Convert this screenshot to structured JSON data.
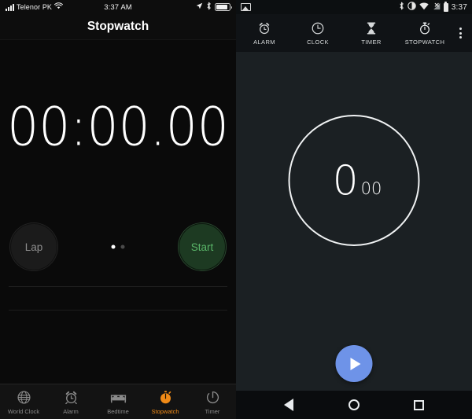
{
  "ios": {
    "status_bar": {
      "carrier": "Telenor PK",
      "time": "3:37 AM",
      "icons": [
        "signal-bars-icon",
        "wifi-icon",
        "location-arrow-icon",
        "bluetooth-icon",
        "battery-icon"
      ]
    },
    "title": "Stopwatch",
    "elapsed_time": "00:00.00",
    "lap_label": "Lap",
    "start_label": "Start",
    "page_dots": {
      "count": 2,
      "active_index": 0
    },
    "tabs": [
      {
        "label": "World Clock",
        "icon": "globe-icon",
        "active": false
      },
      {
        "label": "Alarm",
        "icon": "alarm-clock-icon",
        "active": false
      },
      {
        "label": "Bedtime",
        "icon": "bed-icon",
        "active": false
      },
      {
        "label": "Stopwatch",
        "icon": "stopwatch-icon",
        "active": true
      },
      {
        "label": "Timer",
        "icon": "timer-icon",
        "active": false
      }
    ],
    "colors": {
      "background": "#0a0a0a",
      "accent": "#f08a17",
      "start_text": "#59b468",
      "start_fill": "#1d3a22"
    }
  },
  "android": {
    "status_bar": {
      "time": "3:37",
      "icons": [
        "photo-icon",
        "bluetooth-icon",
        "vibrate-icon",
        "wifi-icon",
        "cell-signal-off-icon",
        "battery-icon"
      ]
    },
    "tabs": [
      {
        "label": "ALARM",
        "icon": "alarm-clock-icon",
        "active": false
      },
      {
        "label": "CLOCK",
        "icon": "clock-icon",
        "active": false
      },
      {
        "label": "TIMER",
        "icon": "hourglass-icon",
        "active": false
      },
      {
        "label": "STOPWATCH",
        "icon": "stopwatch-icon",
        "active": true
      }
    ],
    "overflow_menu": "more-options-icon",
    "elapsed_seconds": "0",
    "elapsed_hundredths": "00",
    "start_button": "play-icon",
    "nav_bar": [
      "back-icon",
      "home-icon",
      "recents-icon"
    ],
    "colors": {
      "background": "#1b2023",
      "tab_bar": "#101316",
      "fab": "#6e93e8",
      "circle_stroke": "#f0f2f3"
    }
  }
}
